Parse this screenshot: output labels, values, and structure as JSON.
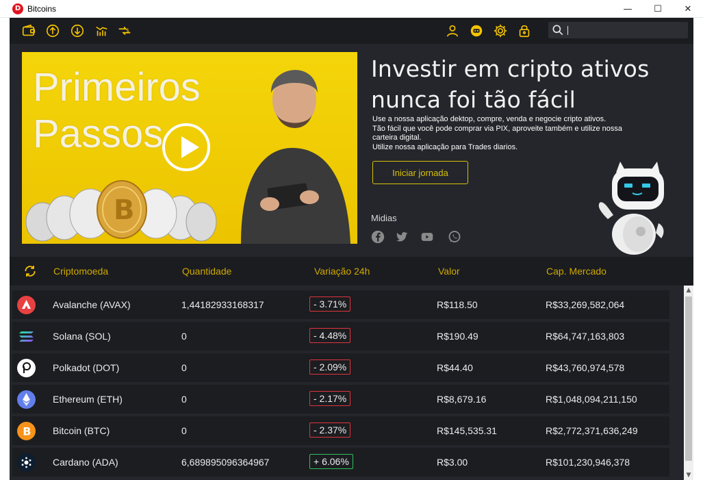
{
  "window": {
    "title": "Bitcoins",
    "app_icon_letter": "D",
    "minimize": "—",
    "maximize": "☐",
    "close": "✕"
  },
  "toolbar": {
    "left_icons": [
      "wallet-icon",
      "upload-icon",
      "download-icon",
      "chart-icon",
      "exchange-icon"
    ],
    "right_icons": [
      "user-icon",
      "mascot-icon",
      "gear-icon",
      "lock-icon"
    ],
    "search_value": ""
  },
  "hero": {
    "banner_text_line1": "Primeiros",
    "banner_text_line2": "Passos",
    "title_line1": "Investir em cripto ativos",
    "title_line2": "nunca foi tão fácil",
    "desc_line1": "Use a nossa aplicação dektop, compre, venda e negocie cripto ativos.",
    "desc_line2": "Tão fácil que você pode comprar via PIX, aproveite também e utilize nossa",
    "desc_line3": "carteira digital.",
    "desc_line4": "Utilize nossa aplicação para Trades diarios.",
    "cta_label": "Iniciar jornada",
    "media_label": "Midias",
    "social_icons": [
      "facebook-icon",
      "twitter-icon",
      "youtube-icon",
      "whatsapp-icon"
    ]
  },
  "table": {
    "headers": {
      "coin": "Criptomoeda",
      "quantity": "Quantidade",
      "change": "Variação 24h",
      "value": "Valor",
      "market_cap": "Cap. Mercado"
    },
    "rows": [
      {
        "name": "Avalanche (AVAX)",
        "quantity": "1,44182933168317",
        "change": "- 3.71%",
        "trend": "down",
        "value": "R$118.50",
        "market_cap": "R$33,269,582,064",
        "icon": "avalanche-icon",
        "color": "#e84142"
      },
      {
        "name": "Solana (SOL)",
        "quantity": "0",
        "change": "- 4.48%",
        "trend": "down",
        "value": "R$190.49",
        "market_cap": "R$64,747,163,803",
        "icon": "solana-icon",
        "color": "#14f195"
      },
      {
        "name": "Polkadot (DOT)",
        "quantity": "0",
        "change": "- 2.09%",
        "trend": "down",
        "value": "R$44.40",
        "market_cap": "R$43,760,974,578",
        "icon": "polkadot-icon",
        "color": "#ffffff"
      },
      {
        "name": "Ethereum (ETH)",
        "quantity": "0",
        "change": "- 2.17%",
        "trend": "down",
        "value": "R$8,679.16",
        "market_cap": "R$1,048,094,211,150",
        "icon": "ethereum-icon",
        "color": "#627eea"
      },
      {
        "name": "Bitcoin (BTC)",
        "quantity": "0",
        "change": "- 2.37%",
        "trend": "down",
        "value": "R$145,535.31",
        "market_cap": "R$2,772,371,636,249",
        "icon": "bitcoin-icon",
        "color": "#f7931a"
      },
      {
        "name": "Cardano (ADA)",
        "quantity": "6,689895096364967",
        "change": "+ 6.06%",
        "trend": "up",
        "value": "R$3.00",
        "market_cap": "R$101,230,946,378",
        "icon": "cardano-icon",
        "color": "#0d1e30"
      }
    ]
  },
  "colors": {
    "accent": "#cfa900",
    "background": "#24262b",
    "toolbar": "#1b1c20",
    "row": "#1c1d21",
    "down": "#e0343c",
    "up": "#2ec15a"
  }
}
